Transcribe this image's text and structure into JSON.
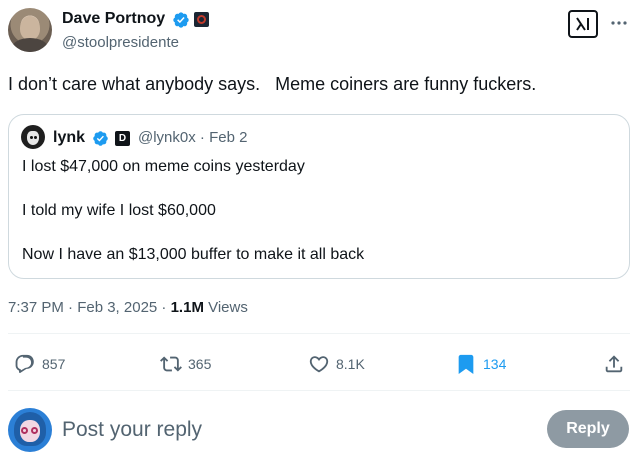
{
  "tweet": {
    "author": {
      "name": "Dave Portnoy",
      "handle": "@stoolpresidente"
    },
    "text": "I don’t care what anybody says.   Meme coiners are funny fuckers.",
    "quote": {
      "author_name": "lynk",
      "meta": "@lynk0x · Feb 2",
      "badge_letter": "D",
      "lines": [
        "I lost $47,000 on meme coins yesterday",
        "I told my wife I lost $60,000",
        "Now I have an $13,000 buffer to make it all back"
      ]
    },
    "timestamp": "7:37 PM · Feb 3, 2025 · ",
    "views_count": "1.1M",
    "views_label": " Views"
  },
  "actions": {
    "replies": "857",
    "reposts": "365",
    "likes": "8.1K",
    "bookmarks": "134"
  },
  "composer": {
    "placeholder": "Post your reply",
    "reply_label": "Reply"
  },
  "colors": {
    "verified": "#1d9bf0",
    "bookmark_active": "#1d9bf0",
    "muted_text": "#536471",
    "reply_button_bg": "#8e9aa3"
  },
  "icons": [
    "verified-badge-icon",
    "affiliate-badge-icon",
    "grok-icon",
    "more-icon",
    "reply-icon",
    "repost-icon",
    "like-icon",
    "bookmark-icon",
    "share-icon"
  ]
}
